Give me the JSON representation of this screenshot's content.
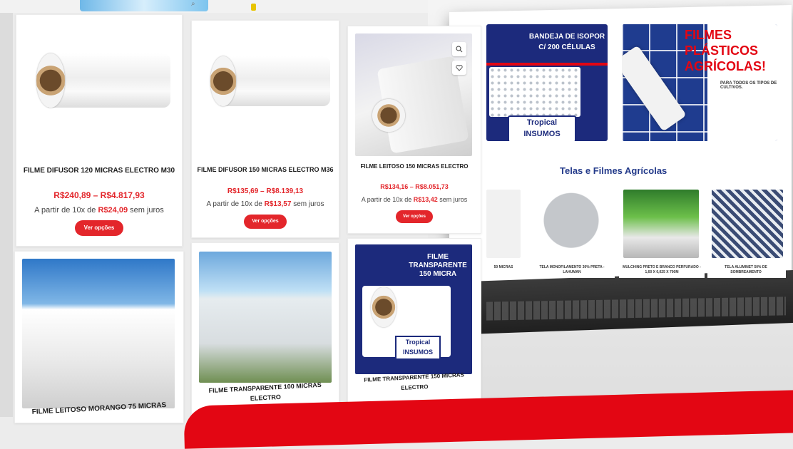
{
  "section": {
    "title": "Telas e Filmes Agrícolas"
  },
  "banners": [
    {
      "title": "BANDEJA DE ISOPOR C/ 200 CÉLULAS",
      "logo": "Tropical INSUMOS"
    },
    {
      "title": "FILMES PLÁSTICOS AGRÍCOLAS!",
      "subtitle": "PARA TODOS OS TIPOS DE CULTIVOS."
    }
  ],
  "mini_products": [
    {
      "label": "50 MICRAS"
    },
    {
      "label": "TELA MONOFILAMENTO 30% PRETA - LAHUMAN"
    },
    {
      "label": "MULCHING PRETO E BRANCO PERFURADO - 1,60 X 0,025 X 700M"
    },
    {
      "label": "TELA ALUMINET 50% DE SOMBREAMENTO"
    }
  ],
  "products": [
    {
      "name": "FILME DIFUSOR 120 MICRAS ELECTRO M30",
      "price": "R$240,89 – R$4.817,93",
      "install_prefix": "A partir de 10x de",
      "install_value": "R$24,09",
      "install_suffix": "sem juros",
      "button": "Ver opções"
    },
    {
      "name": "FILME DIFUSOR 150 MICRAS ELECTRO M36",
      "price": "R$135,69 – R$8.139,13",
      "install_prefix": "A partir de 10x de",
      "install_value": "R$13,57",
      "install_suffix": "sem juros",
      "button": "Ver opções"
    },
    {
      "name": "FILME LEITOSO 150 MICRAS ELECTRO",
      "price": "R$134,16 – R$8.051,73",
      "install_prefix": "A partir de 10x de",
      "install_value": "R$13,42",
      "install_suffix": "sem juros",
      "button": "Ver opções"
    },
    {
      "name": "FILME LEITOSO MORANGO 75 MICRAS"
    },
    {
      "name": "FILME TRANSPARENTE 100 MICRAS ELECTRO"
    },
    {
      "name": "FILME TRANSPARENTE 150 MICRAS ELECTRO",
      "badge": "FILME TRANSPARENTE 150 MICRA"
    }
  ],
  "icons": [
    "search-icon",
    "heart-icon"
  ]
}
